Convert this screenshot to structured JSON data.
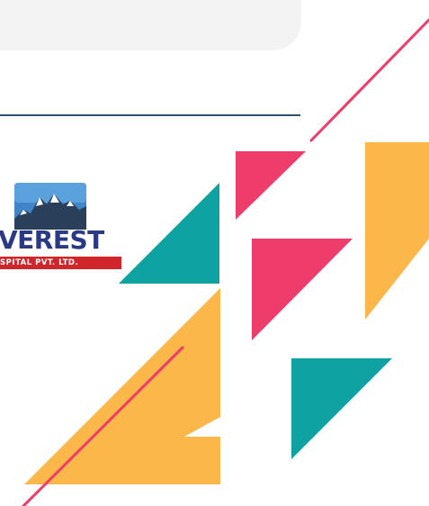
{
  "logo": {
    "name": "VEREST",
    "subtitle": "SPITAL PVT. LTD."
  },
  "colors": {
    "rule": "#2a527f",
    "pink": "#ee3d6a",
    "teal": "#0ea3a2",
    "yellow": "#fbb74a"
  }
}
